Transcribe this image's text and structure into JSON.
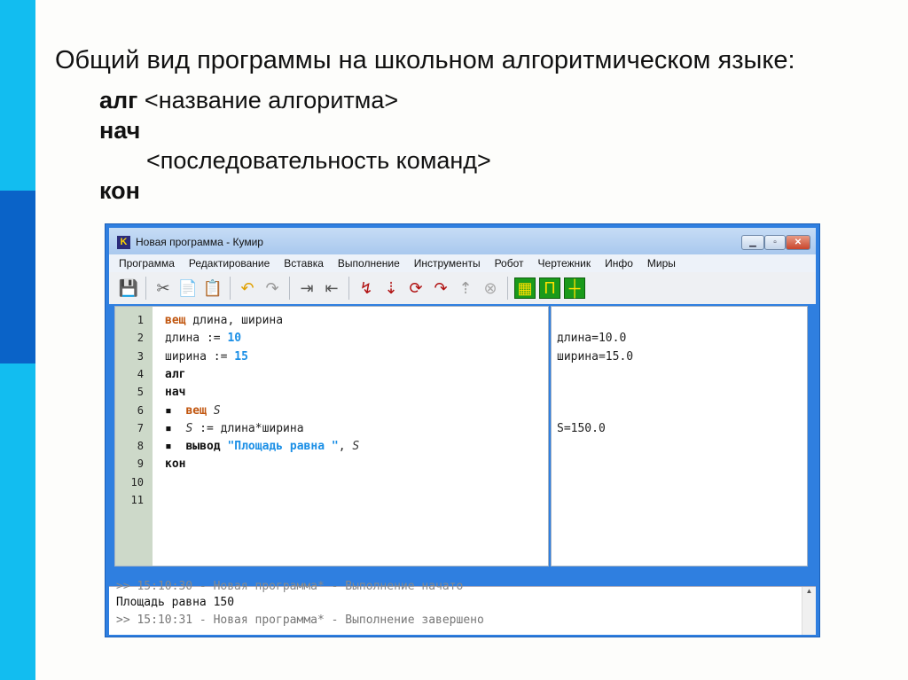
{
  "slide": {
    "heading": "Общий вид программы на школьном алгоритмическом языке:",
    "lines": [
      {
        "kw": "алг",
        "rest": " <название алгоритма>"
      },
      {
        "kw": "нач",
        "rest": ""
      },
      {
        "kw": "",
        "rest": "<последовательность команд>"
      },
      {
        "kw": "кон",
        "rest": ""
      }
    ],
    "colors": {
      "bar_light": "#12bdf0",
      "bar_dark": "#0a63c8"
    }
  },
  "window": {
    "app_icon": "K",
    "title": "Новая программа - Кумир",
    "controls": [
      "minimize-icon",
      "maximize-icon",
      "close-icon"
    ],
    "menu": [
      "Программа",
      "Редактирование",
      "Вставка",
      "Выполнение",
      "Инструменты",
      "Робот",
      "Чертежник",
      "Инфо",
      "Миры"
    ],
    "toolbar": [
      {
        "name": "save-icon",
        "glyph": "💾"
      },
      {
        "sep": true
      },
      {
        "name": "cut-icon",
        "glyph": "✂"
      },
      {
        "name": "copy-icon",
        "glyph": "📄"
      },
      {
        "name": "paste-icon",
        "glyph": "📋"
      },
      {
        "sep": true
      },
      {
        "name": "undo-icon",
        "glyph": "↶"
      },
      {
        "name": "redo-icon",
        "glyph": "↷"
      },
      {
        "sep": true
      },
      {
        "name": "indent-icon",
        "glyph": "⇥"
      },
      {
        "name": "outdent-icon",
        "glyph": "⇤"
      },
      {
        "sep": true
      },
      {
        "name": "run-icon",
        "glyph": "↯"
      },
      {
        "name": "run-step-icon",
        "glyph": "⇣"
      },
      {
        "name": "step-over-icon",
        "glyph": "⟳"
      },
      {
        "name": "step-into-icon",
        "glyph": "↷"
      },
      {
        "name": "step-out-icon",
        "glyph": "⇡"
      },
      {
        "name": "stop-icon",
        "glyph": "⊗"
      },
      {
        "sep": true
      },
      {
        "name": "robot-field-icon",
        "glyph": "▦"
      },
      {
        "name": "drawer-icon",
        "glyph": "П"
      },
      {
        "name": "coordinate-icon",
        "glyph": "┼"
      }
    ],
    "code": [
      [
        {
          "t": "kw",
          "v": "вещ"
        },
        {
          "t": "",
          "v": " длина, ширина"
        }
      ],
      [
        {
          "t": "",
          "v": "длина := "
        },
        {
          "t": "num",
          "v": "10"
        }
      ],
      [
        {
          "t": "",
          "v": "ширина := "
        },
        {
          "t": "num",
          "v": "15"
        }
      ],
      [
        {
          "t": "kb",
          "v": "алг"
        }
      ],
      [
        {
          "t": "kb",
          "v": "нач"
        }
      ],
      [
        {
          "t": "kb",
          "v": "▪  "
        },
        {
          "t": "kw",
          "v": "вещ"
        },
        {
          "t": "",
          "v": " "
        },
        {
          "t": "var",
          "v": "S"
        }
      ],
      [
        {
          "t": "kb",
          "v": "▪  "
        },
        {
          "t": "var",
          "v": "S"
        },
        {
          "t": "",
          "v": " := длина*ширина"
        }
      ],
      [
        {
          "t": "kb",
          "v": "▪  "
        },
        {
          "t": "kb",
          "v": "вывод"
        },
        {
          "t": "",
          "v": " "
        },
        {
          "t": "str",
          "v": "\"Площадь равна \""
        },
        {
          "t": "",
          "v": ", "
        },
        {
          "t": "var",
          "v": "S"
        }
      ],
      [
        {
          "t": "kb",
          "v": "кон"
        }
      ],
      [],
      []
    ],
    "line_numbers": [
      "1",
      "2",
      "3",
      "4",
      "5",
      "6",
      "7",
      "8",
      "9",
      "10",
      "11"
    ],
    "margin_values": [
      {
        "line": 2,
        "v": "длина=10.0"
      },
      {
        "line": 3,
        "v": "ширина=15.0"
      },
      {
        "line": 7,
        "v": "S=150.0"
      }
    ],
    "console": [
      ">> 15:10:30 - Новая программа* - Выполнение начато",
      "Площадь равна 150",
      ">> 15:10:31 - Новая программа* - Выполнение завершено"
    ]
  }
}
